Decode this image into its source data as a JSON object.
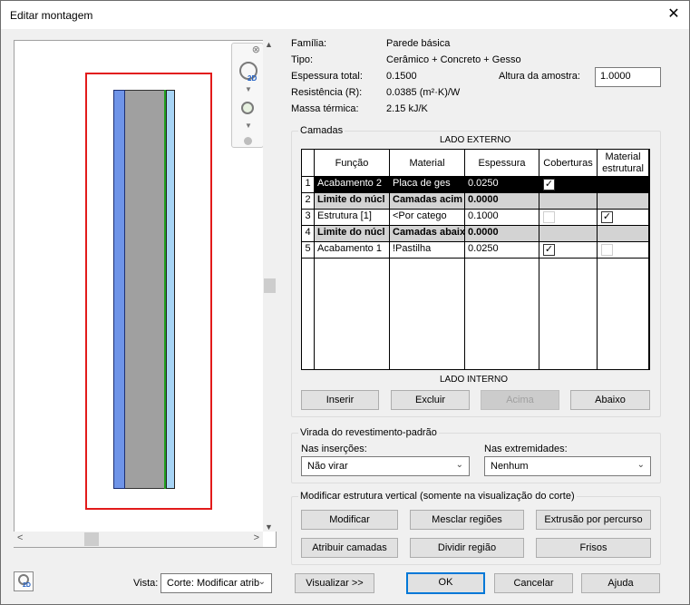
{
  "window": {
    "title": "Editar montagem",
    "close_glyph": "✕"
  },
  "properties": {
    "familia_label": "Família:",
    "familia_value": "Parede básica",
    "tipo_label": "Tipo:",
    "tipo_value": "Cerâmico + Concreto + Gesso",
    "espessura_label": "Espessura total:",
    "espessura_value": "0.1500",
    "altura_label": "Altura da amostra:",
    "altura_value": "1.0000",
    "resistencia_label": "Resistência (R):",
    "resistencia_value": "0.0385 (m²·K)/W",
    "massa_label": "Massa térmica:",
    "massa_value": "2.15 kJ/K"
  },
  "layers": {
    "group_label": "Camadas",
    "top_label": "LADO EXTERNO",
    "bottom_label": "LADO INTERNO",
    "columns": [
      "Função",
      "Material",
      "Espessura",
      "Coberturas",
      "Material estrutural"
    ],
    "rows": [
      {
        "num": "1",
        "funcao": "Acabamento 2",
        "material": "Placa de ges",
        "espessura": "0.0250",
        "coberturas": true,
        "estrutural": false,
        "style": "sel"
      },
      {
        "num": "2",
        "funcao": "Limite do núcl",
        "material": "Camadas acim",
        "espessura": "0.0000",
        "style": "grey"
      },
      {
        "num": "3",
        "funcao": "Estrutura [1]",
        "material": "<Por catego",
        "espessura": "0.1000",
        "coberturas": false,
        "estrutural": true,
        "style": "normal"
      },
      {
        "num": "4",
        "funcao": "Limite do núcl",
        "material": "Camadas abaix",
        "espessura": "0.0000",
        "style": "grey"
      },
      {
        "num": "5",
        "funcao": "Acabamento 1",
        "material": "!Pastilha",
        "espessura": "0.0250",
        "coberturas": true,
        "estrutural": false,
        "style": "normal"
      }
    ],
    "buttons": {
      "inserir": "Inserir",
      "excluir": "Excluir",
      "acima": "Acima",
      "abaixo": "Abaixo"
    }
  },
  "wrapping": {
    "group_label": "Virada do revestimento-padrão",
    "insercoes_label": "Nas inserções:",
    "insercoes_value": "Não virar",
    "extremidades_label": "Nas extremidades:",
    "extremidades_value": "Nenhum"
  },
  "vertical": {
    "group_label": "Modificar estrutura vertical (somente na visualização do corte)",
    "buttons": {
      "modificar": "Modificar",
      "mesclar": "Mesclar regiões",
      "extrusao": "Extrusão por percurso",
      "atribuir": "Atribuir camadas",
      "dividir": "Dividir região",
      "frisos": "Frisos"
    }
  },
  "footer": {
    "vista_label": "Vista:",
    "vista_value": "Corte: Modificar atrib",
    "visualizar": "Visualizar >>",
    "ok": "OK",
    "cancelar": "Cancelar",
    "ajuda": "Ajuda"
  },
  "colors": {
    "accent": "#0078d7",
    "highlight": "#e21b1b",
    "layer_blue": "#6f94e8",
    "layer_grey": "#a0a0a0",
    "layer_lightblue": "#a7d4f5"
  }
}
